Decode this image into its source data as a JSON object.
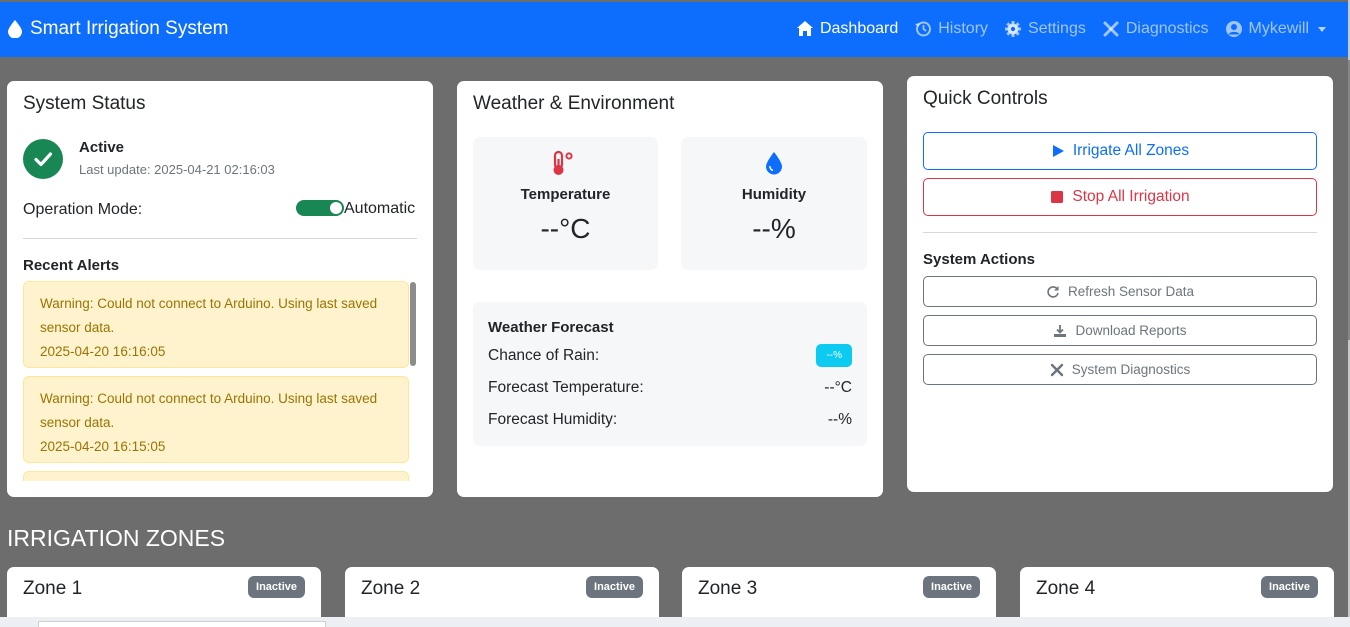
{
  "navbar": {
    "brand": "Smart Irrigation System",
    "items": [
      {
        "label": "Dashboard",
        "icon": "home-icon",
        "active": true
      },
      {
        "label": "History",
        "icon": "history-icon"
      },
      {
        "label": "Settings",
        "icon": "gear-icon"
      },
      {
        "label": "Diagnostics",
        "icon": "tools-icon"
      },
      {
        "label": "Mykewill",
        "icon": "user-icon"
      }
    ]
  },
  "system_status": {
    "title": "System Status",
    "state": "Active",
    "last_update": "Last update: 2025-04-21 02:16:03",
    "mode_label": "Operation Mode:",
    "mode_value": "Automatic",
    "alerts_title": "Recent Alerts",
    "alerts": [
      {
        "message": "Warning: Could not connect to Arduino. Using last saved sensor data.",
        "time": "2025-04-20 16:16:05"
      },
      {
        "message": "Warning: Could not connect to Arduino. Using last saved sensor data.",
        "time": "2025-04-20 16:15:05"
      }
    ]
  },
  "weather": {
    "title": "Weather & Environment",
    "temperature_label": "Temperature",
    "temperature_value": "--°C",
    "humidity_label": "Humidity",
    "humidity_value": "--%",
    "forecast_title": "Weather Forecast",
    "rain_label": "Chance of Rain:",
    "rain_value": "--%",
    "forecast_temp_label": "Forecast Temperature:",
    "forecast_temp_value": "--°C",
    "forecast_humidity_label": "Forecast Humidity:",
    "forecast_humidity_value": "--%"
  },
  "quick_controls": {
    "title": "Quick Controls",
    "irrigate_all": "Irrigate All Zones",
    "stop_all": "Stop All Irrigation",
    "actions_title": "System Actions",
    "refresh": "Refresh Sensor Data",
    "download": "Download Reports",
    "diagnostics": "System Diagnostics"
  },
  "zones": {
    "title": "IRRIGATION ZONES",
    "items": [
      {
        "name": "Zone 1",
        "status": "Inactive"
      },
      {
        "name": "Zone 2",
        "status": "Inactive"
      },
      {
        "name": "Zone 3",
        "status": "Inactive"
      },
      {
        "name": "Zone 4",
        "status": "Inactive"
      }
    ]
  },
  "colors": {
    "primary": "#0d6efd",
    "success": "#198754",
    "danger": "#dc3545",
    "warning_bg": "#fff3cd",
    "info": "#0dcaf0",
    "page_bg": "#6c6d6c"
  }
}
